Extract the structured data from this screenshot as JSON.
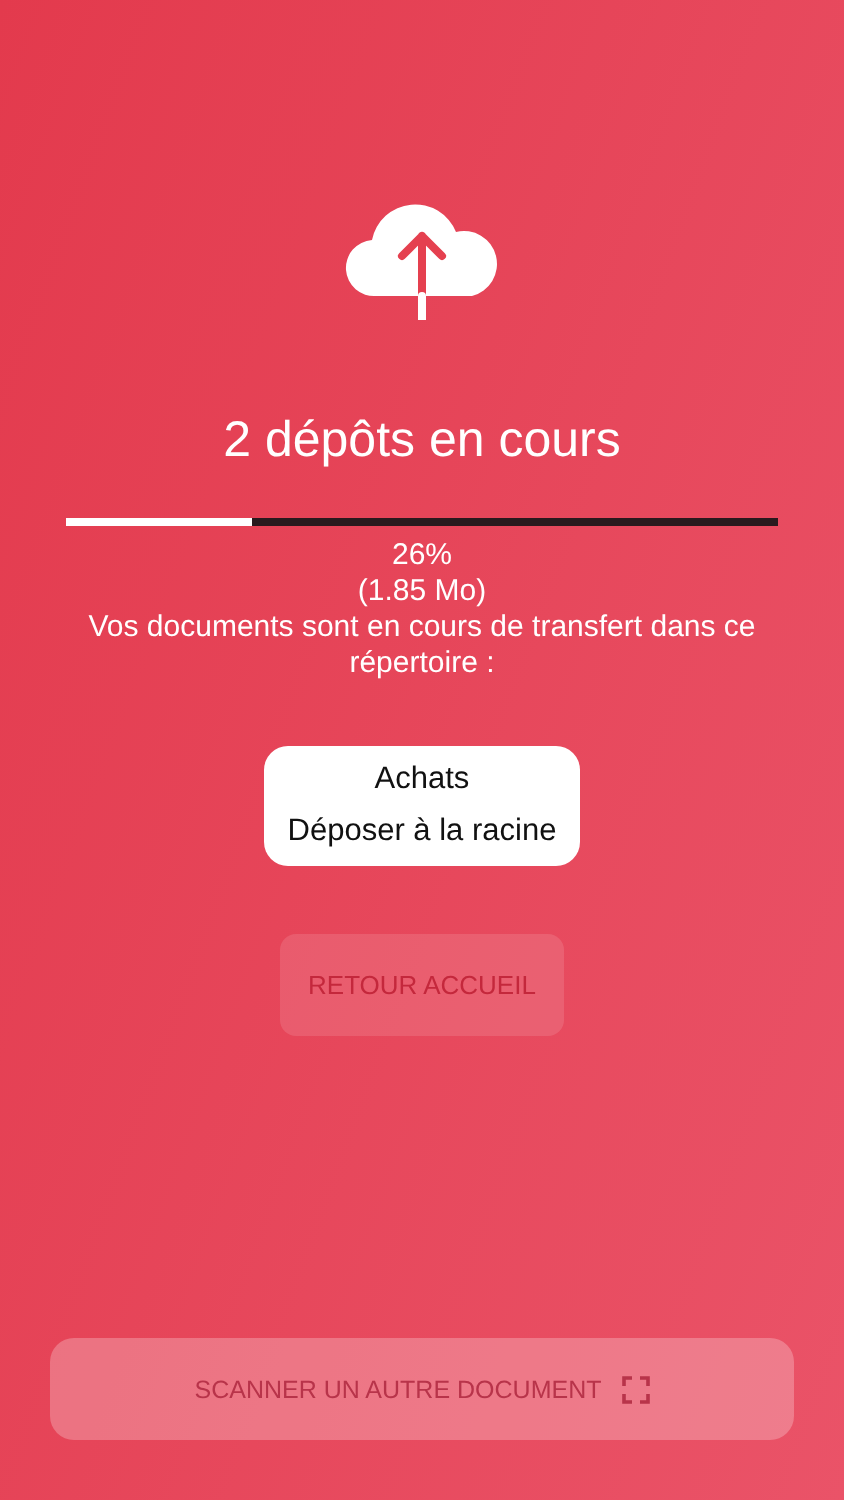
{
  "upload": {
    "title": "2 dépôts en cours",
    "level": 0.26,
    "percent": "26%",
    "size": "(1.85 Mo)",
    "message": "Vos documents sont en cours de transfert dans ce répertoire :"
  },
  "folder_card": {
    "lines": [
      "Achats",
      "Déposer à la racine"
    ]
  },
  "home_button": {
    "label": "RETOUR ACCUEIL"
  },
  "scan_button": {
    "label": "SCANNER UN AUTRE DOCUMENT"
  }
}
